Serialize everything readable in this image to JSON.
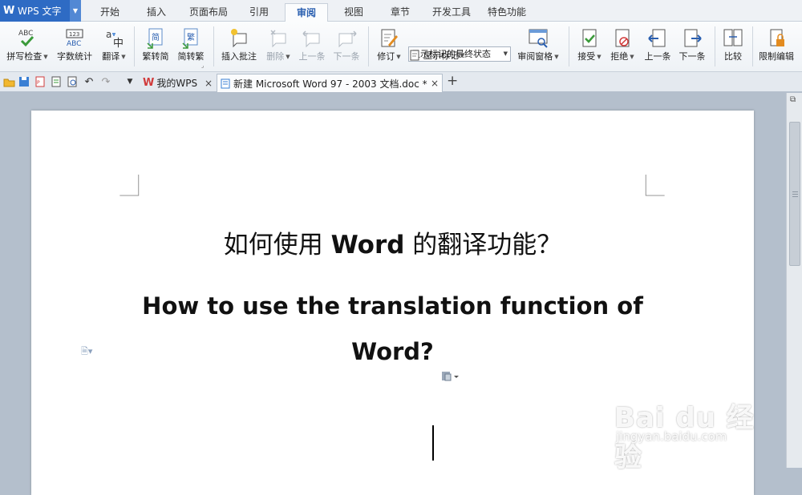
{
  "app": {
    "logo": "W",
    "name": "WPS 文字"
  },
  "menu_tabs": [
    "开始",
    "插入",
    "页面布局",
    "引用",
    "审阅",
    "视图",
    "章节",
    "开发工具",
    "特色功能"
  ],
  "active_menu_tab": "审阅",
  "ribbon": {
    "spell_check": "拼写检查",
    "word_count": "字数统计",
    "translate": "翻译",
    "trad_to_simp": "繁转简",
    "simp_to_trad": "简转繁",
    "insert_comment": "插入批注",
    "delete": "删除",
    "prev_comment": "上一条",
    "next_comment": "下一条",
    "track_changes": "修订",
    "markup_state": "显示标记的最终状态",
    "show_markup": "显示标记",
    "review_pane": "审阅窗格",
    "accept": "接受",
    "reject": "拒绝",
    "prev_change": "上一条",
    "next_change": "下一条",
    "compare": "比较",
    "restrict_editing": "限制编辑"
  },
  "tabs": [
    {
      "label": "我的WPS"
    },
    {
      "label": "新建 Microsoft Word 97 - 2003 文档.doc *"
    }
  ],
  "document": {
    "heading_cn_pre": "如何使用 ",
    "heading_cn_bold": "Word",
    "heading_cn_post": " 的翻译功能？",
    "heading_en_line1": "How to use the translation function of",
    "heading_en_line2": "Word?"
  },
  "watermark": {
    "brand": "Bai du 经验",
    "url": "jingyan.baidu.com"
  },
  "colors": {
    "accent": "#2e6bc4",
    "workspace": "#b4bfcc"
  }
}
